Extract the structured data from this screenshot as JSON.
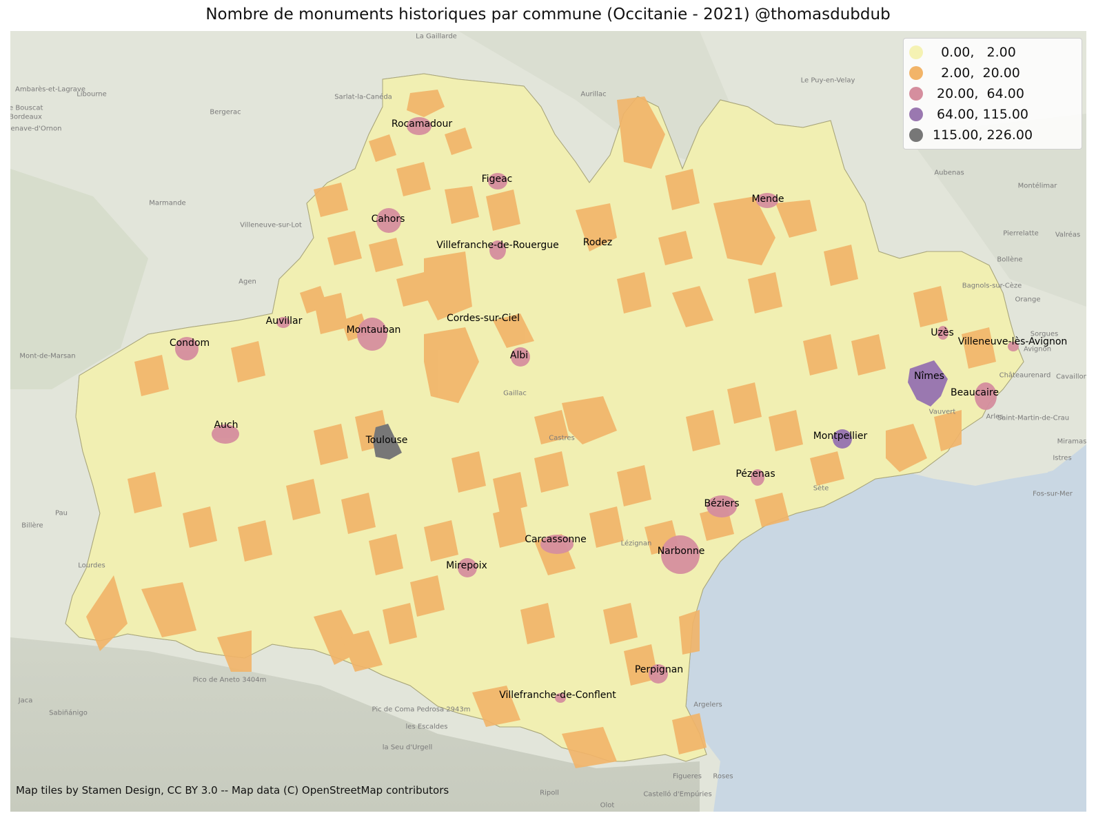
{
  "title": "Nombre de monuments historiques par commune (Occitanie - 2021) @thomasdubdub",
  "attribution": "Map tiles by Stamen Design, CC BY 3.0 -- Map data (C) OpenStreetMap contributors",
  "legend": [
    {
      "label": "  0.00,   2.00",
      "color": "#f5f2b3"
    },
    {
      "label": "  2.00,  20.00",
      "color": "#f2b468"
    },
    {
      "label": " 20.00,  64.00",
      "color": "#d58e9e"
    },
    {
      "label": " 64.00, 115.00",
      "color": "#9a78b0"
    },
    {
      "label": "115.00, 226.00",
      "color": "#777777"
    }
  ],
  "colors": {
    "land": "#dfe3d8",
    "sea": "#c9d7e3",
    "region": "#f1efb2",
    "class_2": "#f2b468",
    "class_3": "#d58e9e",
    "class_4": "#9a78b0",
    "class_5": "#777777"
  },
  "cities": [
    {
      "name": "Rocamadour",
      "class": 3
    },
    {
      "name": "Figeac",
      "class": 3
    },
    {
      "name": "Mende",
      "class": 3
    },
    {
      "name": "Cahors",
      "class": 3
    },
    {
      "name": "Villefranche-de-Rouergue",
      "class": 3
    },
    {
      "name": "Rodez",
      "class": 2
    },
    {
      "name": "Auvillar",
      "class": 3
    },
    {
      "name": "Montauban",
      "class": 3
    },
    {
      "name": "Cordes-sur-Ciel",
      "class": 3
    },
    {
      "name": "Condom",
      "class": 3
    },
    {
      "name": "Albi",
      "class": 3
    },
    {
      "name": "Uzès",
      "class": 3
    },
    {
      "name": "Villeneuve-lès-Avignon",
      "class": 3
    },
    {
      "name": "Nîmes",
      "class": 4
    },
    {
      "name": "Beaucaire",
      "class": 3
    },
    {
      "name": "Auch",
      "class": 3
    },
    {
      "name": "Toulouse",
      "class": 5
    },
    {
      "name": "Montpellier",
      "class": 4
    },
    {
      "name": "Pézenas",
      "class": 3
    },
    {
      "name": "Béziers",
      "class": 3
    },
    {
      "name": "Carcassonne",
      "class": 3
    },
    {
      "name": "Narbonne",
      "class": 3
    },
    {
      "name": "Mirepoix",
      "class": 3
    },
    {
      "name": "Perpignan",
      "class": 3
    },
    {
      "name": "Villefranche-de-Conflent",
      "class": 3
    }
  ],
  "background_places": [
    "Ambarès-et-Lagrave",
    "Libourne",
    "Le Bouscat",
    "Bordeaux",
    "Villenave-d'Ornon",
    "Bergerac",
    "Sarlat-la-Canéda",
    "La Gaillarde",
    "Aurillac",
    "Le Puy-en-Velay",
    "Marmande",
    "Villeneuve-sur-Lot",
    "Agen",
    "Mont-de-Marsan",
    "Pau",
    "Billère",
    "Lourdes",
    "Jaca",
    "Sabiñánigo",
    "Pico de Aneto 3404m",
    "Pic de Coma Pedrosa 2943m",
    "les Escaldes",
    "la Seu d'Urgell",
    "Figueres",
    "Roses",
    "Castelló d'Empúries",
    "Ripoll",
    "Olot",
    "Argelers",
    "Aubenas",
    "Montélimar",
    "Pierrelatte",
    "Bollène",
    "Valréas",
    "Orange",
    "Bagnols-sur-Cèze",
    "Sorgues",
    "Avignon",
    "Châteaurenard",
    "Cavaillon",
    "Arles",
    "Saint-Martin-de-Crau",
    "Miramas",
    "Istres",
    "Fos-sur-Mer",
    "Vauvert",
    "Sète",
    "Gaillac",
    "Castres",
    "Lézignan"
  ]
}
